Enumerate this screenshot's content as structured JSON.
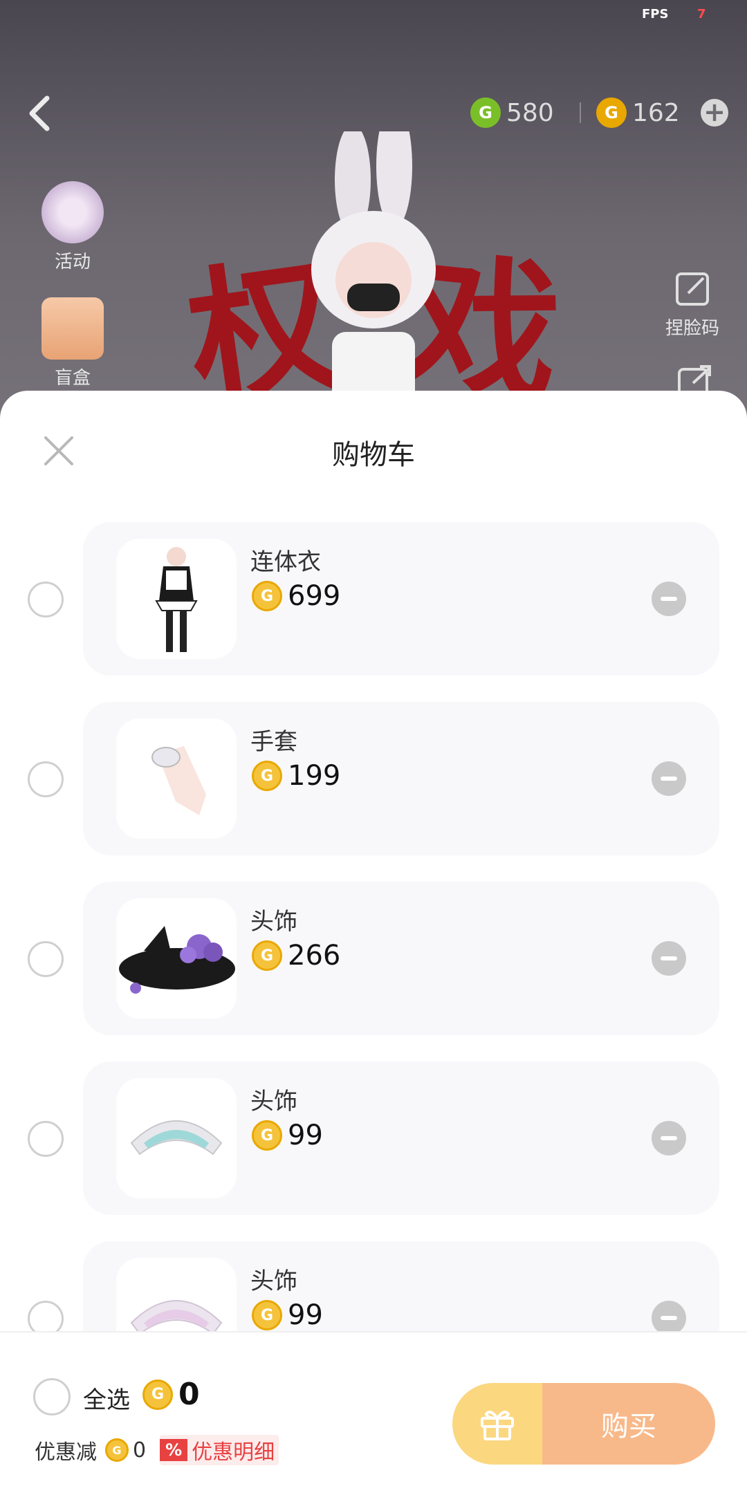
{
  "status": {
    "fps_label": "FPS",
    "fps_value": "7"
  },
  "header": {
    "currency": [
      {
        "id": "green",
        "amount": "580",
        "color": "#7bbf28"
      },
      {
        "id": "gold",
        "amount": "162",
        "color": "#e8a800"
      }
    ]
  },
  "side_left": [
    {
      "label": "活动",
      "icon": "star-badge-icon"
    },
    {
      "label": "盲盒",
      "icon": "gift-box-icon"
    }
  ],
  "side_right": [
    {
      "label": "捏脸码",
      "icon": "edit-icon"
    },
    {
      "label": "",
      "icon": "share-icon"
    }
  ],
  "banner": {
    "chars": [
      "权",
      "戏"
    ]
  },
  "cart": {
    "title": "购物车",
    "items": [
      {
        "name": "连体衣",
        "price": "699"
      },
      {
        "name": "手套",
        "price": "199"
      },
      {
        "name": "头饰",
        "price": "266"
      },
      {
        "name": "头饰",
        "price": "99"
      },
      {
        "name": "头饰",
        "price": "99"
      }
    ]
  },
  "footer": {
    "select_all": "全选",
    "total": "0",
    "discount_label": "优惠减",
    "discount_value": "0",
    "discount_detail": "优惠明细",
    "discount_pct": "%",
    "buy_label": "购买"
  },
  "colors": {
    "gold_coin": "#f5c33b",
    "buy_button": "#f8b98a",
    "gift_button": "#fbd780",
    "discount_red": "#e84141"
  }
}
